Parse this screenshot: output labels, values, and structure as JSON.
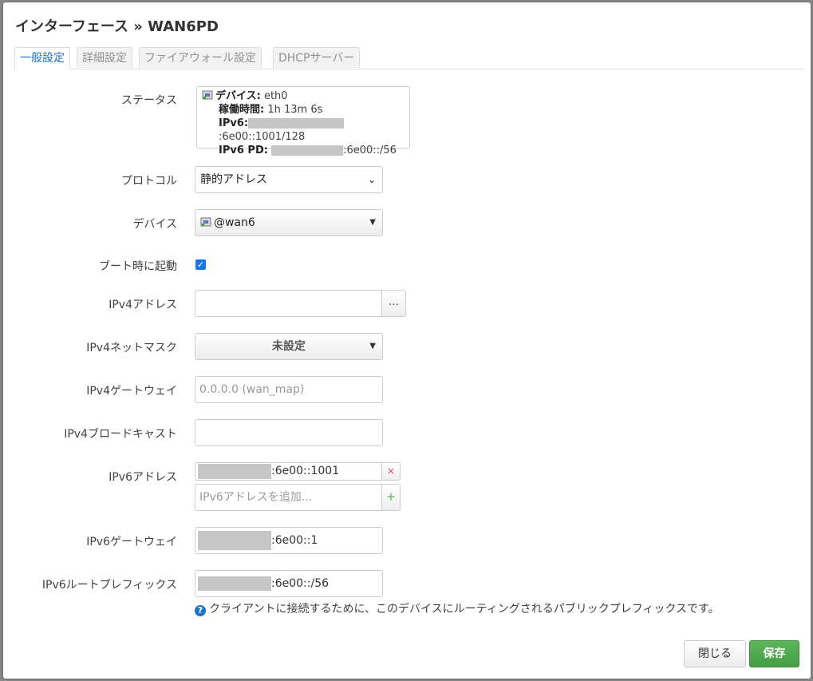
{
  "modal": {
    "title": "インターフェース » WAN6PD",
    "tabs": [
      {
        "label": "一般設定",
        "active": true
      },
      {
        "label": "詳細設定"
      },
      {
        "label": "ファイアウォール設定"
      },
      {
        "label": "DHCPサーバー"
      }
    ]
  },
  "form": {
    "status": {
      "label": "ステータス",
      "device_key": "デバイス:",
      "device_val": "eth0",
      "uptime_key": "稼働時間:",
      "uptime_val": "1h 13m 6s",
      "ipv6_key": "IPv6:",
      "ipv6_val": ":6e00::1001/128",
      "ipv6pd_key": "IPv6 PD:",
      "ipv6pd_val": ":6e00::/56"
    },
    "protocol": {
      "label": "プロトコル",
      "value": "静的アドレス"
    },
    "device": {
      "label": "デバイス",
      "value": "@wan6"
    },
    "bootstart": {
      "label": "ブート時に起動",
      "checked": true
    },
    "ipv4addr": {
      "label": "IPv4アドレス",
      "value": "",
      "button": "…"
    },
    "ipv4mask": {
      "label": "IPv4ネットマスク",
      "value": "未設定"
    },
    "ipv4gw": {
      "label": "IPv4ゲートウェイ",
      "placeholder": "0.0.0.0 (wan_map)"
    },
    "ipv4bcast": {
      "label": "IPv4ブロードキャスト",
      "value": ""
    },
    "ipv6addr": {
      "label": "IPv6アドレス",
      "value": ":6e00::1001",
      "remove": "×",
      "add_placeholder": "IPv6アドレスを追加...",
      "add": "+"
    },
    "ipv6gw": {
      "label": "IPv6ゲートウェイ",
      "value": ":6e00::1"
    },
    "ipv6prefix": {
      "label": "IPv6ルートプレフィックス",
      "value": ":6e00::/56",
      "help": "クライアントに接続するために、このデバイスにルーティングされるパブリックプレフィックスです。"
    }
  },
  "footer": {
    "close": "閉じる",
    "save": "保存"
  },
  "icons": {
    "device": "network-port-icon",
    "help": "question-icon"
  },
  "colors": {
    "accent": "#1a73c7",
    "save": "#4cae4c",
    "remove": "#d9534f",
    "add": "#5cb85c"
  }
}
